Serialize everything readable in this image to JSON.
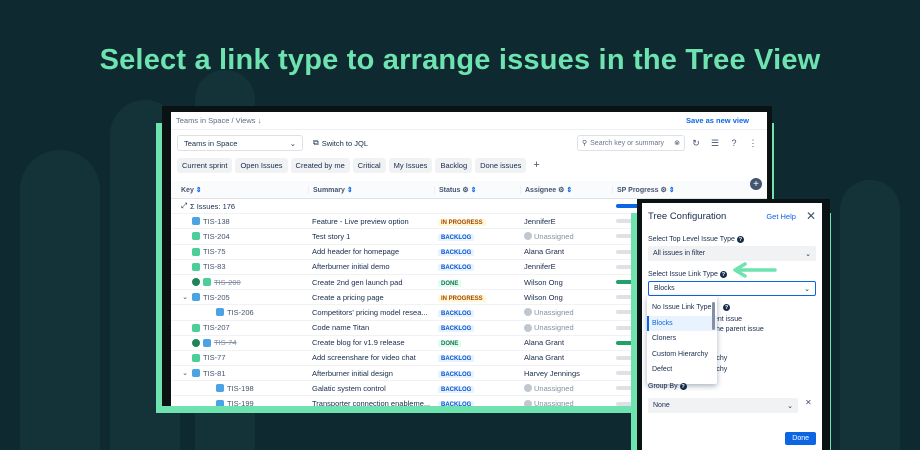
{
  "headline": "Select a link type to arrange issues in the Tree View",
  "colors": {
    "accent": "#6ee3b0",
    "background": "#0e2a30",
    "link": "#0c66e4"
  },
  "topbar": {
    "breadcrumb": "Teams in Space  /  Views ↓",
    "save_label": "Save as new view"
  },
  "toolbar": {
    "project_select": "Teams in Space",
    "switch_jql": "Switch to JQL",
    "search_placeholder": "Search key or summary"
  },
  "filters": [
    "Current sprint",
    "Open Issues",
    "Created by me",
    "Critical",
    "My Issues",
    "Backlog",
    "Done issues"
  ],
  "columns": {
    "key": "Key",
    "summary": "Summary",
    "status": "Status",
    "assignee": "Assignee",
    "sp": "SP Progress"
  },
  "tree_root": "Σ Issues: 176",
  "rows": [
    {
      "key": "TIS-138",
      "summary": "Feature - Live preview option",
      "status": "IN PROGRESS",
      "assignee": "JenniferE",
      "type": "task",
      "indent": 0,
      "done": false,
      "chev": ""
    },
    {
      "key": "TIS-204",
      "summary": "Test story 1",
      "status": "BACKLOG",
      "assignee": "Unassigned",
      "type": "story",
      "indent": 0,
      "done": false,
      "chev": ""
    },
    {
      "key": "TIS-75",
      "summary": "Add header for homepage",
      "status": "BACKLOG",
      "assignee": "Alana Grant",
      "type": "story",
      "indent": 0,
      "done": false,
      "chev": ""
    },
    {
      "key": "TIS-83",
      "summary": "Afterburner initial demo",
      "status": "BACKLOG",
      "assignee": "JenniferE",
      "type": "story",
      "indent": 0,
      "done": false,
      "chev": ""
    },
    {
      "key": "TIS-200",
      "summary": "Create 2nd gen launch pad",
      "status": "DONE",
      "assignee": "Wilson Ong",
      "type": "story",
      "indent": 0,
      "done": true,
      "chev": ""
    },
    {
      "key": "TIS-205",
      "summary": "Create a pricing page",
      "status": "IN PROGRESS",
      "assignee": "Wilson Ong",
      "type": "task",
      "indent": 0,
      "done": false,
      "chev": "v"
    },
    {
      "key": "TIS-206",
      "summary": "Competitors' pricing model resea...",
      "status": "BACKLOG",
      "assignee": "Unassigned",
      "type": "sub",
      "indent": 1,
      "done": false,
      "chev": ""
    },
    {
      "key": "TIS-207",
      "summary": "Code name Titan",
      "status": "BACKLOG",
      "assignee": "Unassigned",
      "type": "story",
      "indent": 0,
      "done": false,
      "chev": ""
    },
    {
      "key": "TIS-74",
      "summary": "Create blog for v1.9 release",
      "status": "DONE",
      "assignee": "Alana Grant",
      "type": "task",
      "indent": 0,
      "done": true,
      "chev": ""
    },
    {
      "key": "TIS-77",
      "summary": "Add screenshare for video chat",
      "status": "BACKLOG",
      "assignee": "Alana Grant",
      "type": "story",
      "indent": 0,
      "done": false,
      "chev": ""
    },
    {
      "key": "TIS-81",
      "summary": "Afterburner initial design",
      "status": "BACKLOG",
      "assignee": "Harvey Jennings",
      "type": "task",
      "indent": 0,
      "done": false,
      "chev": "v"
    },
    {
      "key": "TIS-198",
      "summary": "Galatic system control",
      "status": "BACKLOG",
      "assignee": "Unassigned",
      "type": "sub",
      "indent": 1,
      "done": false,
      "chev": ""
    },
    {
      "key": "TIS-199",
      "summary": "Transporter connection enableme...",
      "status": "BACKLOG",
      "assignee": "Unassigned",
      "type": "sub",
      "indent": 1,
      "done": false,
      "chev": ""
    }
  ],
  "panel": {
    "title": "Tree Configuration",
    "help": "Get Help",
    "top_level_label": "Select Top Level Issue Type",
    "top_level_value": "All issues in filter",
    "link_type_label": "Select Issue Link Type",
    "link_type_value": "Blocks",
    "dropdown_options": [
      "No Issue Link Type",
      "Blocks",
      "Cloners",
      "Custom Hierarchy",
      "Defect"
    ],
    "dropdown_selected": "Blocks",
    "behind_text_1": "ent issue",
    "behind_text_2": "the parent issue",
    "behind_text_3": "rchy",
    "behind_text_4": "rchy",
    "group_by_label": "Group By",
    "group_by_value": "None",
    "done_label": "Done"
  }
}
